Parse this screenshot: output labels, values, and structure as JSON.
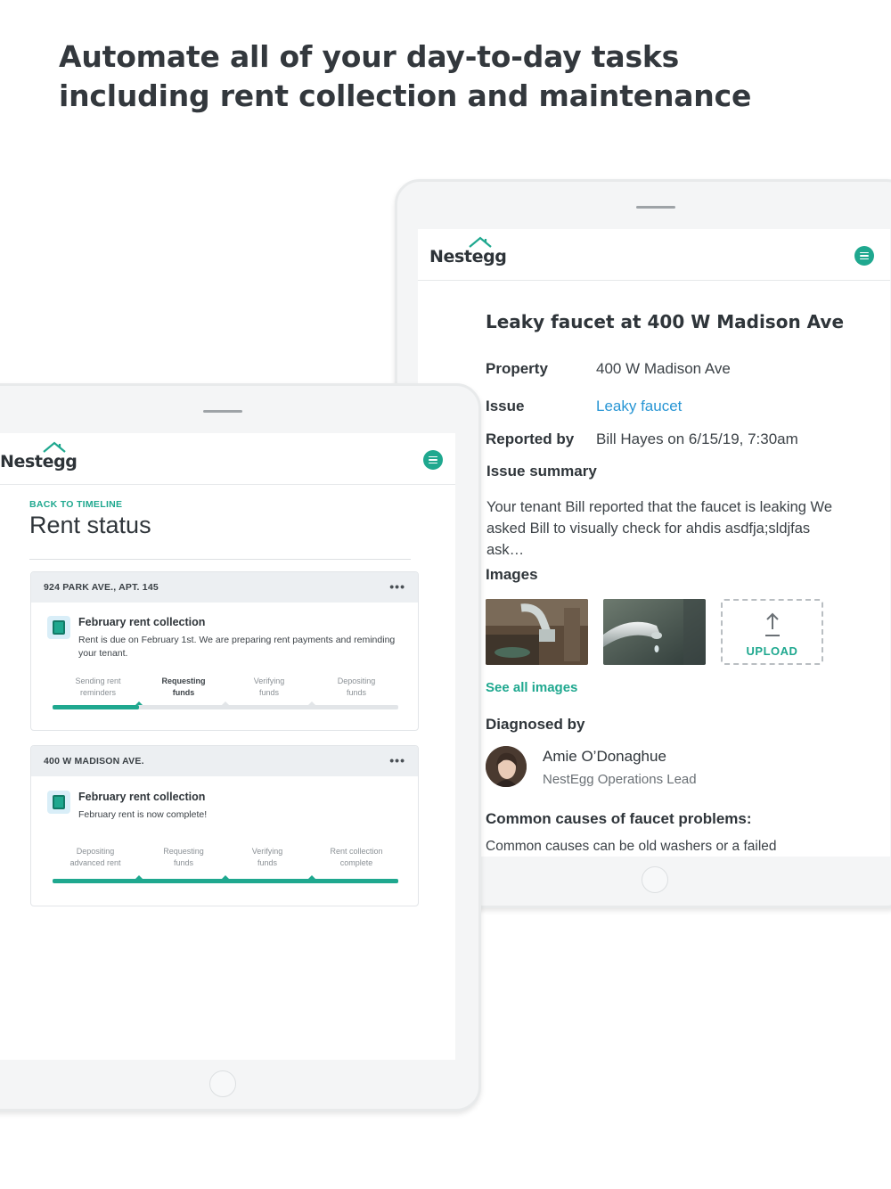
{
  "headline": {
    "line1": "Automate all of your day-to-day tasks",
    "line2": "including rent collection and maintenance"
  },
  "colors": {
    "brand": "#1fa88f",
    "link": "#2795d4",
    "text_dark": "#2f353a",
    "card_header": "#eceff2"
  },
  "maintenance": {
    "logo": "Nestegg",
    "menu_icon": "menu-icon",
    "title": "Leaky faucet at 400 W Madison Ave",
    "rows": [
      {
        "label": "Property",
        "value": "400 W Madison Ave"
      },
      {
        "label": "Issue",
        "value": "Leaky faucet"
      },
      {
        "label": "Reported by",
        "value": "Bill Hayes on 6/15/19, 7:30am"
      }
    ],
    "summary_label": "Issue summary",
    "summary_text": "Your tenant Bill reported that the faucet is leaking We asked Bill to visually check for ahdis asdfja;sldjfas ask…",
    "images_label": "Images",
    "upload_label": "UPLOAD",
    "upload_icon": "upload-arrow-icon",
    "see_all": "See all images",
    "diagnosed_label": "Diagnosed by",
    "diagnosed_name": "Amie O’Donaghue",
    "diagnosed_role": "NestEgg Operations Lead",
    "causes_title": "Common causes of faucet problems:",
    "causes_text": "Common causes can be old washers or a failed"
  },
  "rent": {
    "logo": "Nestegg",
    "menu_icon": "menu-icon",
    "back_link": "BACK TO TIMELINE",
    "title": "Rent status",
    "cards": [
      {
        "address": "924 PARK AVE., APT. 145",
        "more": "•••",
        "icon": "rent-money-icon",
        "title": "February rent collection",
        "description": "Rent is due on February 1st. We are preparing rent payments and reminding your tenant.",
        "progress": 0.25,
        "steps": [
          {
            "line1": "Sending rent",
            "line2": "reminders"
          },
          {
            "line1": "Requesting",
            "line2": "funds"
          },
          {
            "line1": "Verifying",
            "line2": "funds"
          },
          {
            "line1": "Depositing",
            "line2": "funds"
          }
        ],
        "active_step_index": 1
      },
      {
        "address": "400 W MADISON AVE.",
        "more": "•••",
        "icon": "rent-money-icon",
        "title": "February rent collection",
        "description": "February rent is now complete!",
        "progress": 1.0,
        "steps": [
          {
            "line1": "Depositing",
            "line2": "advanced rent"
          },
          {
            "line1": "Requesting",
            "line2": "funds"
          },
          {
            "line1": "Verifying",
            "line2": "funds"
          },
          {
            "line1": "Rent collection",
            "line2": "complete"
          }
        ],
        "active_step_index": -1
      }
    ]
  }
}
